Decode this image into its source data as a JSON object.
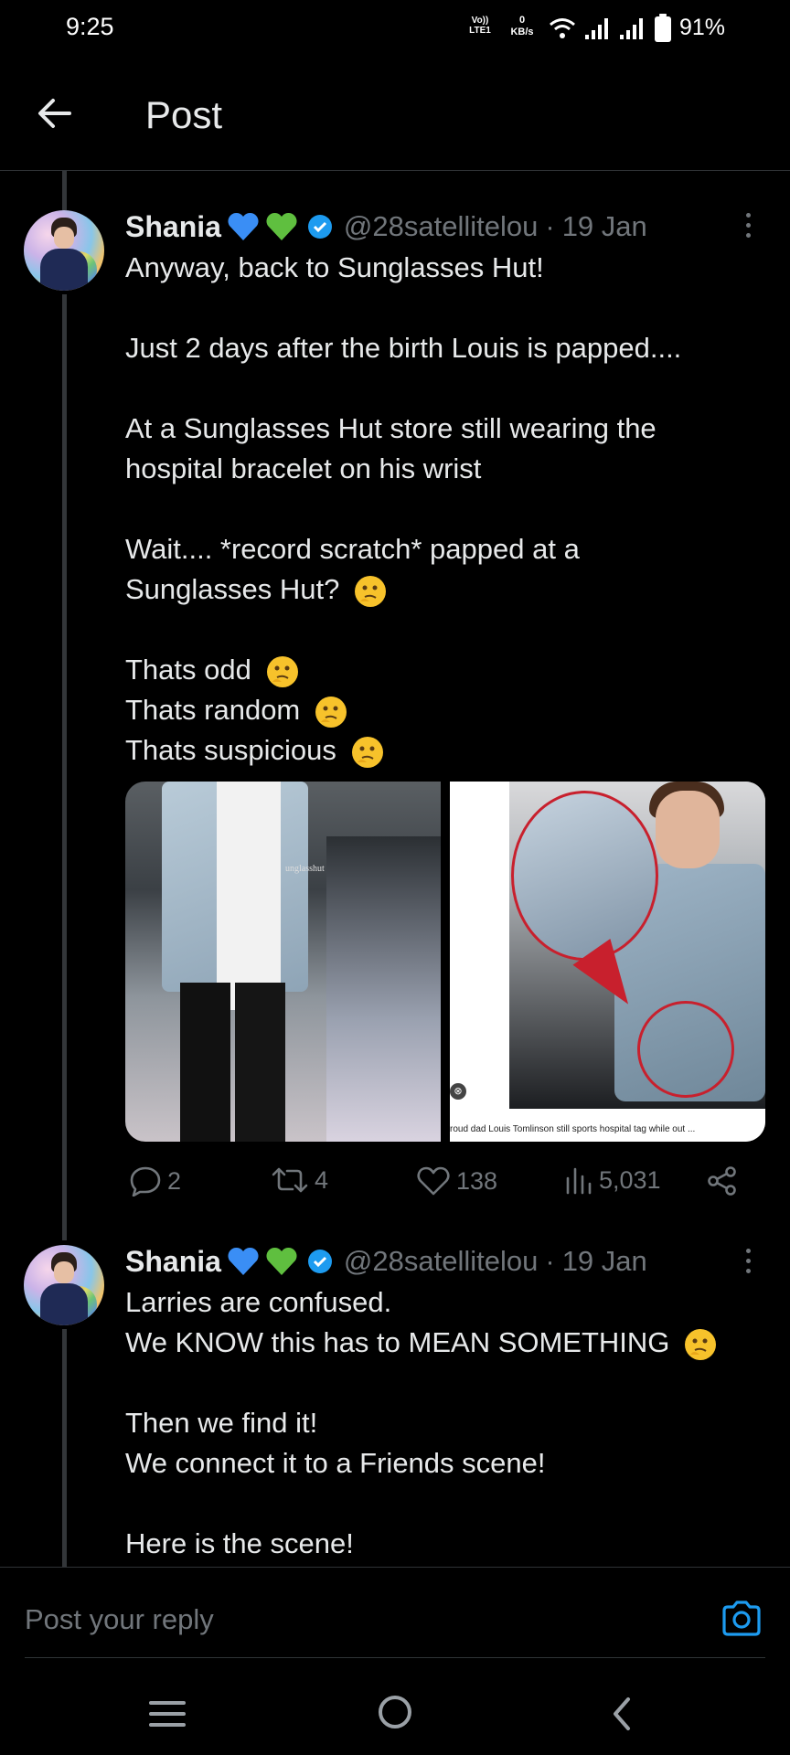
{
  "status_bar": {
    "time": "9:25",
    "network_top": "Vo))",
    "network_bottom": "LTE1",
    "speed_value": "0",
    "speed_unit": "KB/s",
    "battery": "91%"
  },
  "header": {
    "title": "Post",
    "back_icon": "arrow-left-icon"
  },
  "tweets": [
    {
      "name": "Shania",
      "handle": "@28satellitelou",
      "separator": "·",
      "date": "19 Jan",
      "emoji_after_name": [
        "blue-heart",
        "green-heart"
      ],
      "lines": [
        "Anyway, back to Sunglasses Hut!",
        "",
        "Just 2 days after the birth Louis is papped....",
        "",
        "At a Sunglasses Hut store still wearing the",
        "hospital bracelet on his wrist",
        "",
        "Wait.... *record scratch* papped at a",
        "Sunglasses Hut?",
        "",
        "Thats odd",
        "Thats random",
        "Thats suspicious"
      ],
      "media": {
        "image1_text": "unglasshut",
        "image2_caption": "roud dad Louis Tomlinson still sports hospital tag while out ..."
      },
      "actions": {
        "replies": "2",
        "reposts": "4",
        "likes": "138",
        "views": "5,031"
      }
    },
    {
      "name": "Shania",
      "handle": "@28satellitelou",
      "separator": "·",
      "date": "19 Jan",
      "emoji_after_name": [
        "blue-heart",
        "green-heart"
      ],
      "lines": [
        "Larries are confused.",
        "We KNOW this has to MEAN SOMETHING",
        "",
        "Then we find it!",
        "We connect it to a Friends scene!",
        "",
        "Here is the scene!"
      ]
    }
  ],
  "reply_bar": {
    "placeholder": "Post your reply",
    "camera_icon": "camera-icon"
  },
  "colors": {
    "background": "#000000",
    "text": "#e7e9ea",
    "muted": "#71767b",
    "accent": "#1d9bf0",
    "divider": "#2f3336"
  }
}
